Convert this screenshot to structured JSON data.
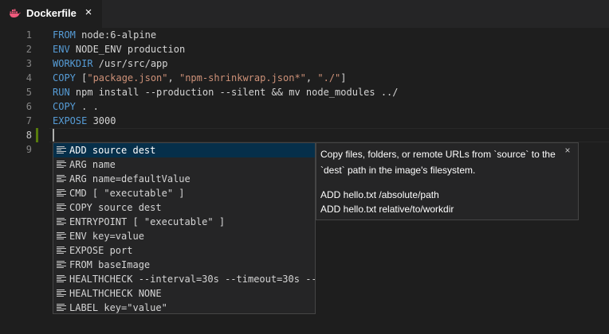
{
  "tab": {
    "title": "Dockerfile",
    "close_glyph": "×",
    "icon": "docker-whale-icon",
    "icon_color": "#ef5a7c"
  },
  "editor": {
    "lines": [
      {
        "number": "1",
        "keyword": "FROM",
        "rest": " node:6-alpine"
      },
      {
        "number": "2",
        "keyword": "ENV",
        "rest": " NODE_ENV production"
      },
      {
        "number": "3",
        "keyword": "WORKDIR",
        "rest": " /usr/src/app"
      },
      {
        "number": "4",
        "keyword": "COPY",
        "rest_a": " [",
        "s1": "\"package.json\"",
        "rest_b": ", ",
        "s2": "\"npm-shrinkwrap.json*\"",
        "rest_c": ", ",
        "s3": "\"./\"",
        "rest_d": "]"
      },
      {
        "number": "5",
        "keyword": "RUN",
        "rest": " npm install --production --silent && mv node_modules ../"
      },
      {
        "number": "6",
        "keyword": "COPY",
        "rest": " . ."
      },
      {
        "number": "7",
        "keyword": "EXPOSE",
        "rest": " 3000"
      },
      {
        "number": "8"
      },
      {
        "number": "9"
      }
    ],
    "keyword_color": "#569cd6",
    "string_color": "#ce9178"
  },
  "suggest": {
    "items": [
      "ADD source dest",
      "ARG name",
      "ARG name=defaultValue",
      "CMD [ \"executable\" ]",
      "COPY source dest",
      "ENTRYPOINT [ \"executable\" ]",
      "ENV key=value",
      "EXPOSE port",
      "FROM baseImage",
      "HEALTHCHECK --interval=30s --timeout=30s --",
      "HEALTHCHECK NONE",
      "LABEL key=\"value\""
    ],
    "item_icon": "snippet-icon",
    "selected_index": 0
  },
  "details": {
    "description": "Copy files, folders, or remote URLs from `source` to the `dest` path in the image's filesystem.",
    "examples": [
      "ADD hello.txt /absolute/path",
      "ADD hello.txt relative/to/workdir"
    ],
    "close_glyph": "×"
  }
}
